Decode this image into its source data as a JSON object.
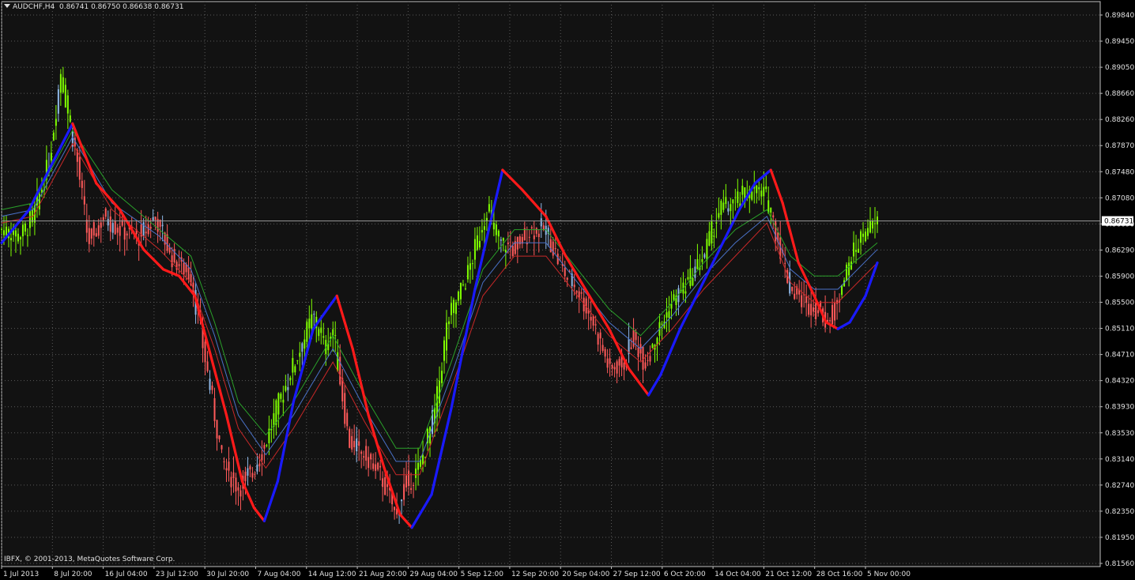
{
  "header": {
    "symbol": "AUDCHF,H4",
    "ohlc": "0.86741 0.86750 0.86638 0.86731"
  },
  "copyright": "IBFX, © 2001-2013, MetaQuotes Software Corp.",
  "current_price_label": "0.86731",
  "colors": {
    "background": "#121212",
    "grid": "#5a5a5a",
    "bull_candle": "#7fff00",
    "bear_candle": "#ff5a5a",
    "neutral_candle": "#8fb8e8",
    "trend_up": "#1a1aff",
    "trend_down": "#ff1a1a",
    "ma_green": "#2aa02a",
    "ma_blue": "#4a72c8",
    "ma_red": "#c82828",
    "axis_text": "#e0e0e0"
  },
  "chart_data": {
    "type": "line",
    "title": "AUDCHF,H4",
    "y_ticks": [
      "0.89840",
      "0.89450",
      "0.89050",
      "0.88660",
      "0.88260",
      "0.87870",
      "0.87480",
      "0.87080",
      "0.86690",
      "0.86290",
      "0.85900",
      "0.85500",
      "0.85110",
      "0.84710",
      "0.84320",
      "0.83930",
      "0.83530",
      "0.83140",
      "0.82740",
      "0.82350",
      "0.81950",
      "0.81560"
    ],
    "ylim": [
      0.8156,
      0.8984
    ],
    "x_ticks": [
      "1 Jul 2013",
      "8 Jul 20:00",
      "16 Jul 04:00",
      "23 Jul 12:00",
      "30 Jul 20:00",
      "7 Aug 04:00",
      "14 Aug 12:00",
      "21 Aug 20:00",
      "29 Aug 04:00",
      "5 Sep 12:00",
      "12 Sep 20:00",
      "20 Sep 04:00",
      "27 Sep 12:00",
      "6 Oct 20:00",
      "14 Oct 04:00",
      "21 Oct 12:00",
      "28 Oct 16:00",
      "5 Nov 00:00"
    ],
    "grid": true,
    "current_price": 0.86731,
    "series": [
      {
        "role": "price_path",
        "points": [
          [
            0,
            0.866
          ],
          [
            25,
            0.865
          ],
          [
            40,
            0.868
          ],
          [
            60,
            0.876
          ],
          [
            75,
            0.89
          ],
          [
            85,
            0.883
          ],
          [
            95,
            0.877
          ],
          [
            110,
            0.864
          ],
          [
            130,
            0.868
          ],
          [
            150,
            0.866
          ],
          [
            175,
            0.865
          ],
          [
            195,
            0.868
          ],
          [
            215,
            0.862
          ],
          [
            240,
            0.859
          ],
          [
            260,
            0.845
          ],
          [
            280,
            0.831
          ],
          [
            300,
            0.827
          ],
          [
            320,
            0.83
          ],
          [
            335,
            0.834
          ],
          [
            355,
            0.841
          ],
          [
            375,
            0.847
          ],
          [
            395,
            0.853
          ],
          [
            410,
            0.848
          ],
          [
            420,
            0.851
          ],
          [
            440,
            0.834
          ],
          [
            460,
            0.832
          ],
          [
            480,
            0.829
          ],
          [
            500,
            0.823
          ],
          [
            510,
            0.827
          ],
          [
            530,
            0.83
          ],
          [
            550,
            0.839
          ],
          [
            565,
            0.852
          ],
          [
            590,
            0.859
          ],
          [
            615,
            0.869
          ],
          [
            630,
            0.864
          ],
          [
            650,
            0.863
          ],
          [
            670,
            0.866
          ],
          [
            690,
            0.866
          ],
          [
            710,
            0.86
          ],
          [
            730,
            0.857
          ],
          [
            750,
            0.852
          ],
          [
            770,
            0.845
          ],
          [
            790,
            0.846
          ],
          [
            800,
            0.85
          ],
          [
            815,
            0.846
          ],
          [
            830,
            0.85
          ],
          [
            850,
            0.855
          ],
          [
            870,
            0.858
          ],
          [
            890,
            0.862
          ],
          [
            910,
            0.869
          ],
          [
            930,
            0.87
          ],
          [
            950,
            0.872
          ],
          [
            970,
            0.871
          ],
          [
            985,
            0.864
          ],
          [
            1000,
            0.857
          ],
          [
            1020,
            0.855
          ],
          [
            1035,
            0.854
          ],
          [
            1050,
            0.852
          ],
          [
            1060,
            0.856
          ],
          [
            1075,
            0.861
          ],
          [
            1090,
            0.865
          ],
          [
            1110,
            0.867
          ]
        ]
      },
      {
        "role": "trend_line",
        "points": [
          [
            0,
            0.864
          ],
          [
            35,
            0.869
          ],
          [
            60,
            0.875
          ],
          [
            90,
            0.882
          ],
          [
            120,
            0.873
          ],
          [
            150,
            0.869
          ],
          [
            180,
            0.863
          ],
          [
            205,
            0.86
          ],
          [
            225,
            0.859
          ],
          [
            245,
            0.856
          ],
          [
            265,
            0.847
          ],
          [
            285,
            0.838
          ],
          [
            305,
            0.828
          ],
          [
            320,
            0.824
          ],
          [
            333,
            0.822
          ],
          [
            350,
            0.828
          ],
          [
            370,
            0.84
          ],
          [
            395,
            0.851
          ],
          [
            425,
            0.856
          ],
          [
            445,
            0.848
          ],
          [
            465,
            0.838
          ],
          [
            485,
            0.83
          ],
          [
            505,
            0.823
          ],
          [
            520,
            0.821
          ],
          [
            545,
            0.826
          ],
          [
            570,
            0.839
          ],
          [
            600,
            0.857
          ],
          [
            635,
            0.875
          ],
          [
            660,
            0.872
          ],
          [
            690,
            0.868
          ],
          [
            715,
            0.862
          ],
          [
            745,
            0.856
          ],
          [
            770,
            0.851
          ],
          [
            795,
            0.845
          ],
          [
            820,
            0.841
          ],
          [
            835,
            0.844
          ],
          [
            860,
            0.851
          ],
          [
            885,
            0.857
          ],
          [
            910,
            0.863
          ],
          [
            935,
            0.869
          ],
          [
            955,
            0.873
          ],
          [
            975,
            0.875
          ],
          [
            990,
            0.87
          ],
          [
            1010,
            0.861
          ],
          [
            1030,
            0.856
          ],
          [
            1045,
            0.852
          ],
          [
            1060,
            0.851
          ],
          [
            1075,
            0.852
          ],
          [
            1095,
            0.856
          ],
          [
            1110,
            0.861
          ]
        ]
      },
      {
        "role": "ma_green",
        "points": [
          [
            0,
            0.869
          ],
          [
            40,
            0.87
          ],
          [
            90,
            0.881
          ],
          [
            140,
            0.872
          ],
          [
            200,
            0.866
          ],
          [
            240,
            0.862
          ],
          [
            270,
            0.852
          ],
          [
            300,
            0.84
          ],
          [
            335,
            0.835
          ],
          [
            370,
            0.84
          ],
          [
            420,
            0.85
          ],
          [
            460,
            0.841
          ],
          [
            500,
            0.833
          ],
          [
            530,
            0.833
          ],
          [
            570,
            0.846
          ],
          [
            610,
            0.86
          ],
          [
            650,
            0.866
          ],
          [
            690,
            0.866
          ],
          [
            730,
            0.86
          ],
          [
            770,
            0.854
          ],
          [
            810,
            0.85
          ],
          [
            850,
            0.855
          ],
          [
            890,
            0.861
          ],
          [
            930,
            0.866
          ],
          [
            970,
            0.869
          ],
          [
            1000,
            0.862
          ],
          [
            1030,
            0.859
          ],
          [
            1060,
            0.859
          ],
          [
            1110,
            0.864
          ]
        ]
      },
      {
        "role": "ma_blue",
        "points": [
          [
            0,
            0.868
          ],
          [
            40,
            0.869
          ],
          [
            90,
            0.88
          ],
          [
            140,
            0.87
          ],
          [
            200,
            0.865
          ],
          [
            240,
            0.86
          ],
          [
            270,
            0.85
          ],
          [
            300,
            0.838
          ],
          [
            335,
            0.832
          ],
          [
            370,
            0.838
          ],
          [
            420,
            0.848
          ],
          [
            460,
            0.839
          ],
          [
            500,
            0.831
          ],
          [
            530,
            0.831
          ],
          [
            570,
            0.844
          ],
          [
            610,
            0.858
          ],
          [
            650,
            0.864
          ],
          [
            690,
            0.864
          ],
          [
            730,
            0.858
          ],
          [
            770,
            0.852
          ],
          [
            810,
            0.848
          ],
          [
            850,
            0.853
          ],
          [
            890,
            0.859
          ],
          [
            930,
            0.864
          ],
          [
            970,
            0.868
          ],
          [
            1000,
            0.86
          ],
          [
            1030,
            0.857
          ],
          [
            1060,
            0.857
          ],
          [
            1110,
            0.863
          ]
        ]
      },
      {
        "role": "ma_red",
        "points": [
          [
            0,
            0.867
          ],
          [
            40,
            0.868
          ],
          [
            90,
            0.879
          ],
          [
            140,
            0.869
          ],
          [
            200,
            0.863
          ],
          [
            240,
            0.858
          ],
          [
            270,
            0.848
          ],
          [
            300,
            0.836
          ],
          [
            335,
            0.83
          ],
          [
            370,
            0.836
          ],
          [
            420,
            0.846
          ],
          [
            460,
            0.837
          ],
          [
            500,
            0.829
          ],
          [
            530,
            0.829
          ],
          [
            570,
            0.842
          ],
          [
            610,
            0.856
          ],
          [
            650,
            0.862
          ],
          [
            690,
            0.862
          ],
          [
            730,
            0.856
          ],
          [
            770,
            0.85
          ],
          [
            810,
            0.846
          ],
          [
            850,
            0.851
          ],
          [
            890,
            0.857
          ],
          [
            930,
            0.862
          ],
          [
            970,
            0.867
          ],
          [
            1000,
            0.858
          ],
          [
            1030,
            0.855
          ],
          [
            1060,
            0.855
          ],
          [
            1110,
            0.861
          ]
        ]
      }
    ]
  }
}
